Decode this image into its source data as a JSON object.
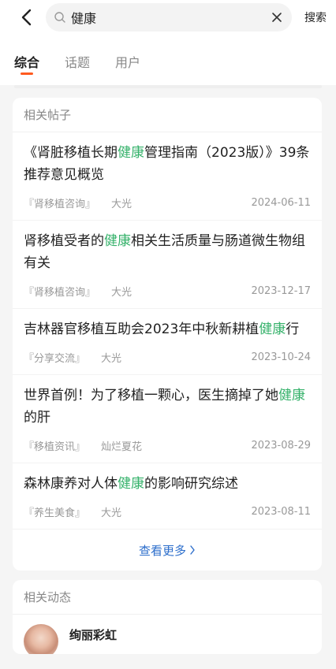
{
  "search": {
    "query": "健康",
    "submit_label": "搜索"
  },
  "tabs": [
    {
      "label": "综合",
      "active": true
    },
    {
      "label": "话题",
      "active": false
    },
    {
      "label": "用户",
      "active": false
    }
  ],
  "posts_section": {
    "title": "相关帖子",
    "posts": [
      {
        "pre": "《肾脏移植长期",
        "hl": "健康",
        "post": "管理指南（2023版）》39条推荐意见概览",
        "category": "『肾移植咨询』",
        "author": "大光",
        "date": "2024-06-11"
      },
      {
        "pre": "肾移植受者的",
        "hl": "健康",
        "post": "相关生活质量与肠道微生物组有关",
        "category": "『肾移植咨询』",
        "author": "大光",
        "date": "2023-12-17"
      },
      {
        "pre": "吉林器官移植互助会2023年中秋新耕植",
        "hl": "健康",
        "post": "行",
        "category": "『分享交流』",
        "author": "大光",
        "date": "2023-10-24"
      },
      {
        "pre": "世界首例！为了移植一颗心，医生摘掉了她",
        "hl": "健康",
        "post": "的肝",
        "category": "『移植资讯』",
        "author": "灿烂夏花",
        "date": "2023-08-29"
      },
      {
        "pre": "森林康养对人体",
        "hl": "健康",
        "post": "的影响研究综述",
        "category": "『养生美食』",
        "author": "大光",
        "date": "2023-08-11"
      }
    ],
    "more_label": "查看更多"
  },
  "dynamics_section": {
    "title": "相关动态",
    "first_user": "绚丽彩虹"
  },
  "colors": {
    "highlight": "#36b26b",
    "accent": "#ff5a1f",
    "link": "#2c6ecb"
  },
  "icons": {
    "back": "chevron-left-icon",
    "search": "search-icon",
    "clear": "close-icon",
    "more": "chevron-right-icon"
  }
}
